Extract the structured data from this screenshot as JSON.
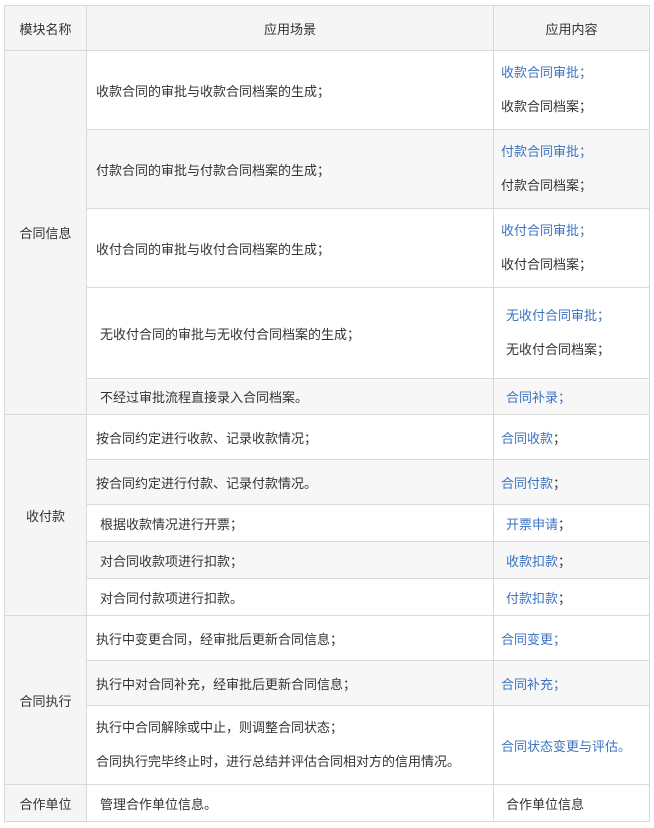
{
  "header": {
    "module": "模块名称",
    "scene": "应用场景",
    "content": "应用内容"
  },
  "contract_info": {
    "module": "合同信息",
    "rows": [
      {
        "scene": "收款合同的审批与收款合同档案的生成；",
        "link": "收款合同审批；",
        "plain": "收款合同档案；"
      },
      {
        "scene": "付款合同的审批与付款合同档案的生成；",
        "link": "付款合同审批；",
        "plain": "付款合同档案；"
      },
      {
        "scene": "收付合同的审批与收付合同档案的生成；",
        "link": "收付合同审批；",
        "plain": "收付合同档案；"
      },
      {
        "scene": "无收付合同的审批与无收付合同档案的生成；",
        "link": "无收付合同审批；",
        "plain": "无收付合同档案；"
      },
      {
        "scene": "不经过审批流程直接录入合同档案。",
        "link": "合同补录；"
      }
    ]
  },
  "payments": {
    "module": "收付款",
    "rows": [
      {
        "scene": "按合同约定进行收款、记录收款情况；",
        "link": "合同收款",
        "sep": "；"
      },
      {
        "scene": "按合同约定进行付款、记录付款情况。",
        "link": "合同付款",
        "sep": "；"
      },
      {
        "scene": "根据收款情况进行开票；",
        "link": "开票申请",
        "sep": "；"
      },
      {
        "scene": "对合同收款项进行扣款；",
        "link": "收款扣款",
        "sep": "；"
      },
      {
        "scene": "对合同付款项进行扣款。",
        "link": "付款扣款",
        "sep": "；"
      }
    ]
  },
  "execution": {
    "module": "合同执行",
    "rows": [
      {
        "scene": "执行中变更合同，经审批后更新合同信息；",
        "link": "合同变更；"
      },
      {
        "scene": "执行中对合同补充，经审批后更新合同信息；",
        "link": "合同补充；"
      },
      {
        "scene_line1": "执行中合同解除或中止，则调整合同状态；",
        "scene_line2": "合同执行完毕终止时，进行总结并评估合同相对方的信用情况。",
        "link": "合同状态变更与评估。"
      }
    ]
  },
  "partner": {
    "module": "合作单位",
    "scene": "管理合作单位信息。",
    "content": "合作单位信息"
  }
}
